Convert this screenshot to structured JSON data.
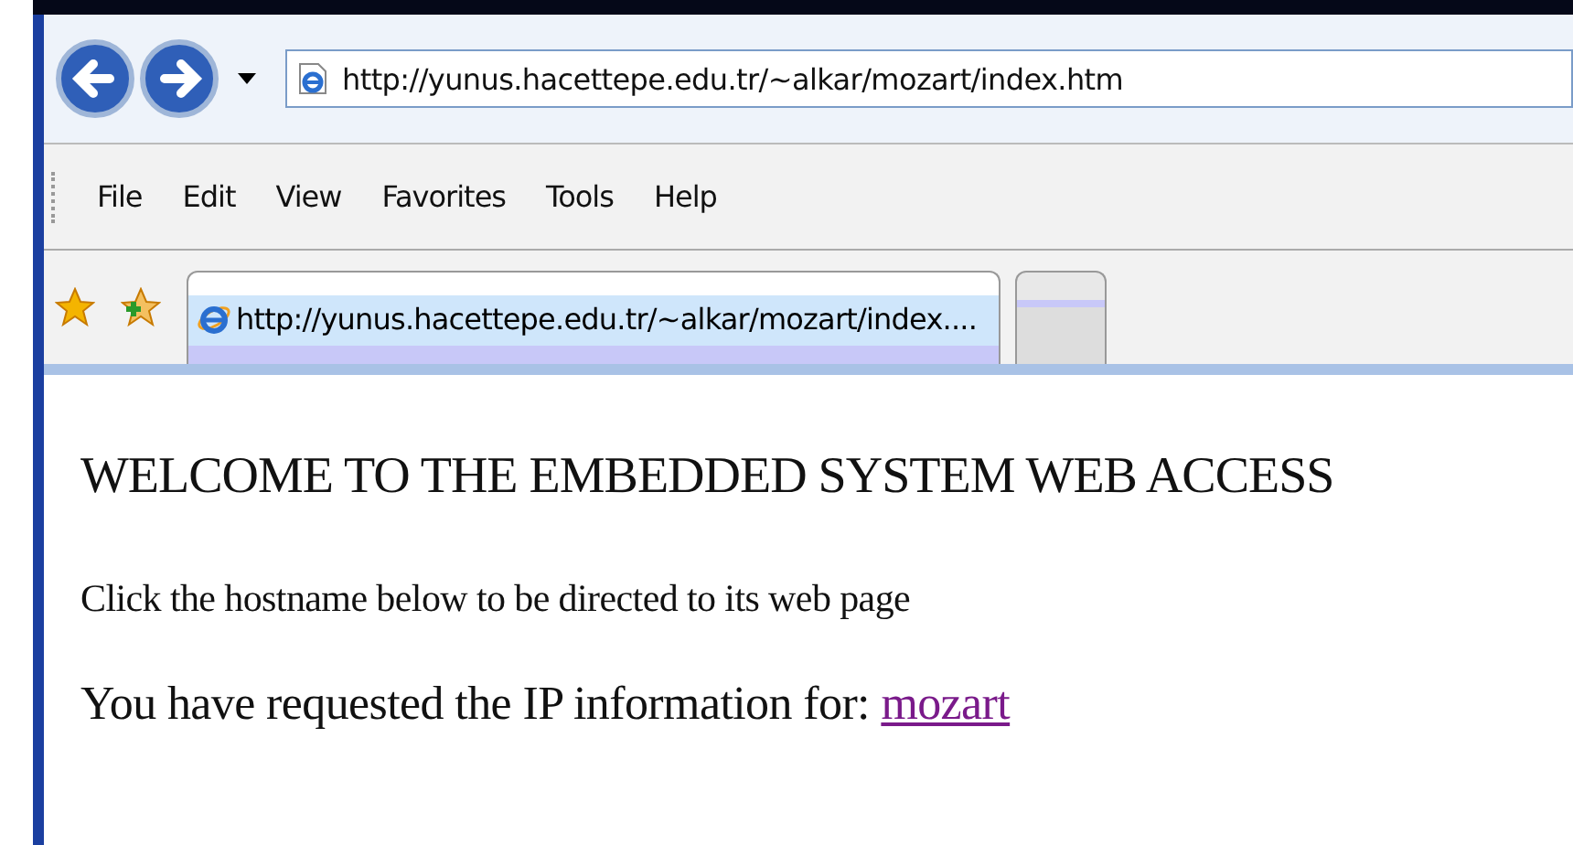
{
  "address_bar": {
    "url": "http://yunus.hacettepe.edu.tr/~alkar/mozart/index.htm"
  },
  "menu": [
    "File",
    "Edit",
    "View",
    "Favorites",
    "Tools",
    "Help"
  ],
  "tabs": [
    {
      "label": "http://yunus.hacettepe.edu.tr/~alkar/mozart/index....",
      "selected": true
    },
    {
      "selected": false
    }
  ],
  "page": {
    "heading": "WELCOME TO THE EMBEDDED SYSTEM WEB ACCESS",
    "instruction": "Click the hostname below to be directed to its web page",
    "info_text": "You have requested the IP information for:",
    "host_link": "mozart"
  }
}
